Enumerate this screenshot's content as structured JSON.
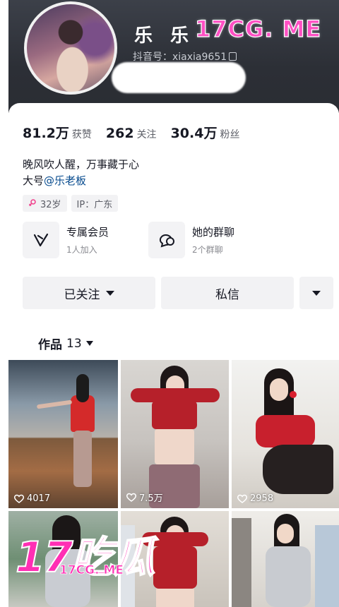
{
  "profile": {
    "username": "乐 乐",
    "douyin_id": "抖音号：xiaxia9651",
    "stats": [
      {
        "value": "81.2万",
        "label": "获赞"
      },
      {
        "value": "262",
        "label": "关注"
      },
      {
        "value": "30.4万",
        "label": "粉丝"
      }
    ],
    "bio_line1": "晚风吹人醒，万事藏于心",
    "bio_line2_prefix": "大号",
    "bio_mention": "@乐老板",
    "tags": [
      {
        "icon": "female-icon",
        "label": "32岁"
      },
      {
        "icon": "",
        "label": "IP：广东"
      }
    ]
  },
  "features": [
    {
      "icon": "membership-icon",
      "title": "专属会员",
      "subtitle": "1人加入"
    },
    {
      "icon": "group-chat-icon",
      "title": "她的群聊",
      "subtitle": "2个群聊"
    }
  ],
  "actions": {
    "follow_label": "已关注",
    "message_label": "私信"
  },
  "works_tab": {
    "label": "作品",
    "count": "13"
  },
  "videos": [
    {
      "likes": "4017"
    },
    {
      "likes": "7.5万"
    },
    {
      "likes": "2958"
    },
    {
      "likes": ""
    },
    {
      "likes": ""
    },
    {
      "likes": ""
    }
  ],
  "watermarks": {
    "top": "17CG. ME",
    "bottom_big": "17吃瓜",
    "bottom_small": "17CG. ME"
  },
  "colors": {
    "header_bg": "#2c2f36",
    "mention": "#04498d",
    "watermark_pink": "#ff2fb4",
    "button_bg": "#f2f2f4"
  }
}
